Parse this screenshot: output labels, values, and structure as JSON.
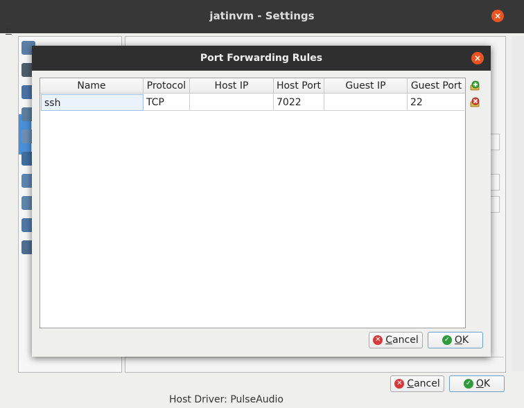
{
  "settings_window": {
    "title": "jatinvm - Settings",
    "menu_initial": "F",
    "cancel_prefix": "C",
    "cancel_rest": "ancel",
    "ok_prefix": "O",
    "ok_rest": "K",
    "host_driver_text": "Host Driver:   PulseAudio"
  },
  "dialog": {
    "title": "Port Forwarding Rules",
    "close_glyph": "×",
    "columns": [
      "Name",
      "Protocol",
      "Host IP",
      "Host Port",
      "Guest IP",
      "Guest Port"
    ],
    "rows": [
      {
        "name": "ssh",
        "protocol": "TCP",
        "host_ip": "",
        "host_port": "7022",
        "guest_ip": "",
        "guest_port": "22"
      }
    ],
    "cancel_prefix": "C",
    "cancel_rest": "ancel",
    "ok_prefix": "O",
    "ok_rest": "K"
  },
  "colors": {
    "accent_close": "#e95420",
    "cancel_icon": "#d6393b",
    "ok_icon": "#2e9c3d",
    "selection": "#eaf2fb"
  },
  "icons": {
    "add_rule": "add-rule-icon",
    "remove_rule": "remove-rule-icon"
  }
}
